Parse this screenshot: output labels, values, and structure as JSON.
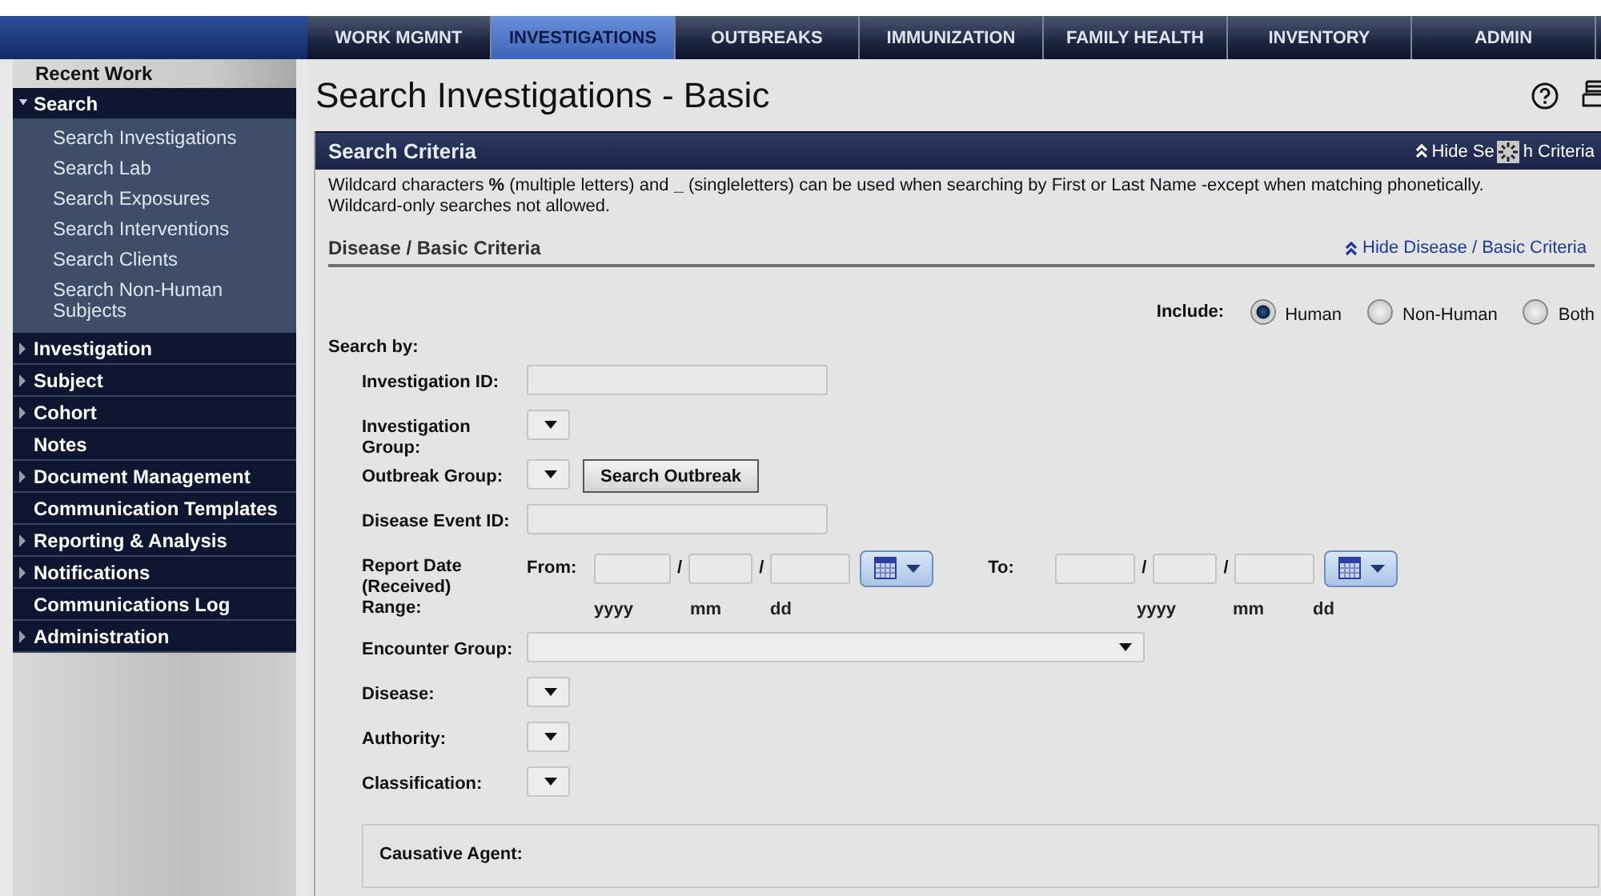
{
  "nav_tabs": [
    {
      "label": "WORK MGMNT",
      "selected": false
    },
    {
      "label": "INVESTIGATIONS",
      "selected": true
    },
    {
      "label": "OUTBREAKS",
      "selected": false
    },
    {
      "label": "IMMUNIZATION",
      "selected": false
    },
    {
      "label": "FAMILY HEALTH",
      "selected": false
    },
    {
      "label": "INVENTORY",
      "selected": false
    },
    {
      "label": "ADMIN",
      "selected": false
    }
  ],
  "sidebar": {
    "recent_work": "Recent Work",
    "items": [
      {
        "label": "Search",
        "kind": "group",
        "expanded": true,
        "children": [
          {
            "label": "Search Investigations"
          },
          {
            "label": "Search Lab"
          },
          {
            "label": "Search Exposures"
          },
          {
            "label": "Search Interventions"
          },
          {
            "label": "Search Clients"
          },
          {
            "label": "Search Non-Human Subjects"
          }
        ]
      },
      {
        "label": "Investigation",
        "kind": "group",
        "expanded": false
      },
      {
        "label": "Subject",
        "kind": "group",
        "expanded": false
      },
      {
        "label": "Cohort",
        "kind": "group",
        "expanded": false
      },
      {
        "label": "Notes",
        "kind": "leaf"
      },
      {
        "label": "Document Management",
        "kind": "group",
        "expanded": false
      },
      {
        "label": "Communication Templates",
        "kind": "leaf"
      },
      {
        "label": "Reporting & Analysis",
        "kind": "group",
        "expanded": false
      },
      {
        "label": "Notifications",
        "kind": "group",
        "expanded": false
      },
      {
        "label": "Communications Log",
        "kind": "leaf"
      },
      {
        "label": "Administration",
        "kind": "group",
        "expanded": false
      }
    ]
  },
  "page": {
    "title": "Search Investigations - Basic"
  },
  "search_criteria": {
    "title": "Search Criteria",
    "hide_link": {
      "before": "Hide Se",
      "after": "h Criteria"
    },
    "note": "Wildcard characters **%** (multiple letters) and **_** (singleletters) can be used when searching by First or Last Name -except when matching phonetically. Wildcard-only searches not allowed."
  },
  "disease_criteria": {
    "title": "Disease / Basic Criteria",
    "hide_link": "Hide Disease / Basic Criteria",
    "include": {
      "label": "Include:",
      "options": [
        {
          "label": "Human",
          "selected": true
        },
        {
          "label": "Non-Human",
          "selected": false
        },
        {
          "label": "Both",
          "selected": false
        }
      ]
    },
    "search_by": "Search by:",
    "fields": [
      {
        "kind": "text",
        "label": "Investigation ID:"
      },
      {
        "kind": "select",
        "label": "Investigation Group:"
      },
      {
        "kind": "select",
        "label": "Outbreak Group:",
        "button": "Search Outbreak"
      },
      {
        "kind": "text",
        "label": "Disease Event ID:"
      },
      {
        "kind": "daterange",
        "label": "Report Date (Received) Range:",
        "from": {
          "label": "From:",
          "separators": [
            "/",
            "/"
          ],
          "hints": [
            "yyyy",
            "mm",
            "dd"
          ]
        },
        "to": {
          "label": "To:",
          "separators": [
            "/",
            "/"
          ],
          "hints": [
            "yyyy",
            "mm",
            "dd"
          ]
        }
      },
      {
        "kind": "wideselect",
        "label": "Encounter Group:"
      },
      {
        "kind": "select",
        "label": "Disease:"
      },
      {
        "kind": "select",
        "label": "Authority:"
      },
      {
        "kind": "select",
        "label": "Classification:"
      }
    ],
    "causative_agent": {
      "label": "Causative Agent:"
    }
  }
}
